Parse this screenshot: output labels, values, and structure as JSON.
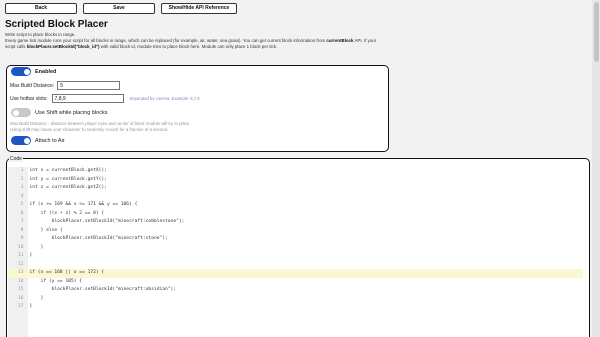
{
  "toolbar": {
    "back": "Back",
    "save": "Save",
    "api": "Show/Hide API Reference"
  },
  "title": "Scripted Block Placer",
  "description": {
    "line1": "Write script to place blocks in range.",
    "line2_a": "Every game tick module runs your script for all blocks in range, which can be replaced (for example, air, water, sea grass). You can get current block information from ",
    "line2_b": "currentBlock",
    "line2_c": " API. If your script calls ",
    "line2_d": "blockPlacer.setBlockId(\"block_id\")",
    "line2_e": " with valid block id, module tries to place block here. Module can only place 1 block per tick."
  },
  "settings": {
    "enabled_label": "Enabled",
    "max_distance_label": "Max Build Distance:",
    "max_distance_value": "5",
    "hotbar_label": "Use hotbar slots:",
    "hotbar_value": "7,8,9",
    "hotbar_hint": "Separated by comma. Example: 6,7,8",
    "shift_label": "Use Shift while placing blocks",
    "note1": "Max Build Distance - distance between player eyes and center of block module will try to place.",
    "note2": "Using shift may cause your character to randomly crouch for a fraction of a second.",
    "attach_label": "Attach to Air"
  },
  "code": {
    "legend": "Code",
    "active_line": 13,
    "lines": [
      "int x = currentBlock.getX();",
      "int y = currentBlock.getY();",
      "int z = currentBlock.getZ();",
      "",
      "if (x >= 169 && x <= 171 && y == 106) {",
      "    if ((x + z) % 2 == 0) {",
      "        blockPlacer.setBlockId(\"minecraft:cobblestone\");",
      "    } else {",
      "        blockPlacer.setBlockId(\"minecraft:stone\");",
      "    }",
      "}",
      "",
      "if (x == 168 || x == 172) {",
      "    if (y == 105) {",
      "        blockPlacer.setBlockId(\"minecraft:obsidian\");",
      "    }",
      "}"
    ],
    "line_numbers": [
      "1",
      "2",
      "3",
      "4",
      "5",
      "6",
      "7",
      "8",
      "9",
      "10",
      "11",
      "12",
      "13",
      "14",
      "15",
      "16",
      "17"
    ]
  }
}
